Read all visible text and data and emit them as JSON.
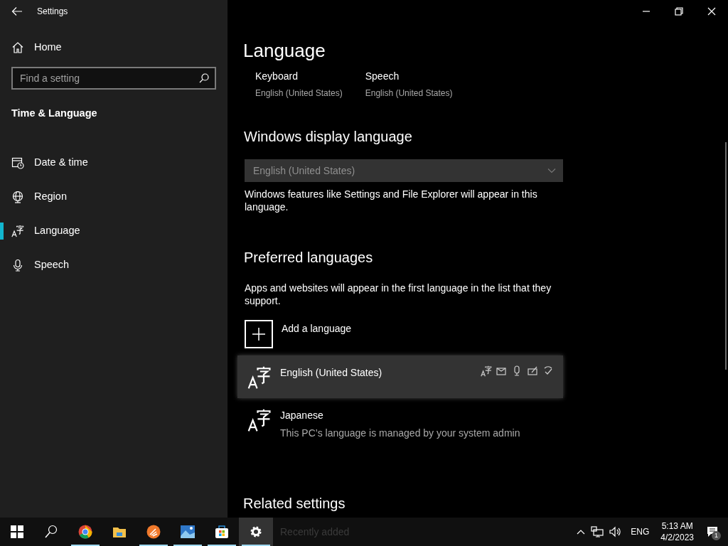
{
  "window": {
    "title": "Settings"
  },
  "sidebar": {
    "home": "Home",
    "search": {
      "placeholder": "Find a setting"
    },
    "section": "Time & Language",
    "items": [
      {
        "label": "Date & time",
        "kind": "calendar",
        "selected": false
      },
      {
        "label": "Region",
        "kind": "globe",
        "selected": false
      },
      {
        "label": "Language",
        "kind": "language",
        "selected": true
      },
      {
        "label": "Speech",
        "kind": "microphone",
        "selected": false
      }
    ]
  },
  "main": {
    "title": "Language",
    "defaults": [
      {
        "label": "Keyboard",
        "value": "English (United States)"
      },
      {
        "label": "Speech",
        "value": "English (United States)"
      }
    ],
    "display_language": {
      "heading": "Windows display language",
      "value": "English (United States)",
      "disabled": true,
      "note": "Windows features like Settings and File Explorer will appear in this language."
    },
    "preferred": {
      "heading": "Preferred languages",
      "note": "Apps and websites will appear in the first language in the list that they support.",
      "add_label": "Add a language",
      "languages": [
        {
          "name": "English (United States)",
          "selected": true,
          "features": true
        },
        {
          "name": "Japanese",
          "subtitle": "This PC’s language is managed by your system admin",
          "selected": false,
          "features": false
        }
      ]
    },
    "related_heading": "Related settings"
  },
  "taskbar": {
    "apps": [
      {
        "kind": "start",
        "running": false,
        "active": false
      },
      {
        "kind": "search",
        "running": false,
        "active": false
      },
      {
        "kind": "chrome",
        "running": true,
        "active": false
      },
      {
        "kind": "folder",
        "running": false,
        "active": false
      },
      {
        "kind": "orange",
        "running": true,
        "active": false
      },
      {
        "kind": "photos",
        "running": true,
        "active": false
      },
      {
        "kind": "store",
        "running": true,
        "active": false
      },
      {
        "kind": "settings",
        "running": true,
        "active": true
      }
    ],
    "ghost_text": "Recently added",
    "tray": {
      "input_language": "ENG",
      "time": "5:13 AM",
      "date": "4/2/2023",
      "notifications": "1"
    }
  }
}
